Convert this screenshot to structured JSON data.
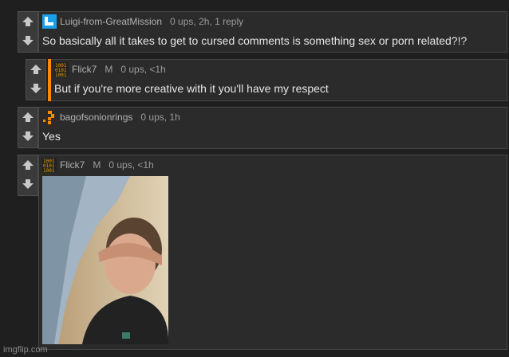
{
  "comments": [
    {
      "user": "Luigi-from-GreatMission",
      "mod": "",
      "meta": "0 ups, 2h, 1 reply",
      "text": "So basically all it takes to get to cursed comments is something sex or porn related?!?"
    },
    {
      "user": "Flick7",
      "mod": "M",
      "meta": "0 ups, <1h",
      "text": "But if you're more creative with it you'll have my respect"
    },
    {
      "user": "bagofsonionrings",
      "mod": "",
      "meta": "0 ups, 1h",
      "text": "Yes"
    },
    {
      "user": "Flick7",
      "mod": "M",
      "meta": "0 ups, <1h",
      "text": ""
    }
  ],
  "avatars": {
    "luigi": "blue-square-avatar-icon",
    "flick": "binary-digits-avatar-icon",
    "bag": "orange-pixel-avatar-icon"
  },
  "colors": {
    "accent_orange": "#ff8a00",
    "avatar_blue": "#1aa0e8",
    "background": "#1f1f1f"
  },
  "watermark": "imgflip.com"
}
